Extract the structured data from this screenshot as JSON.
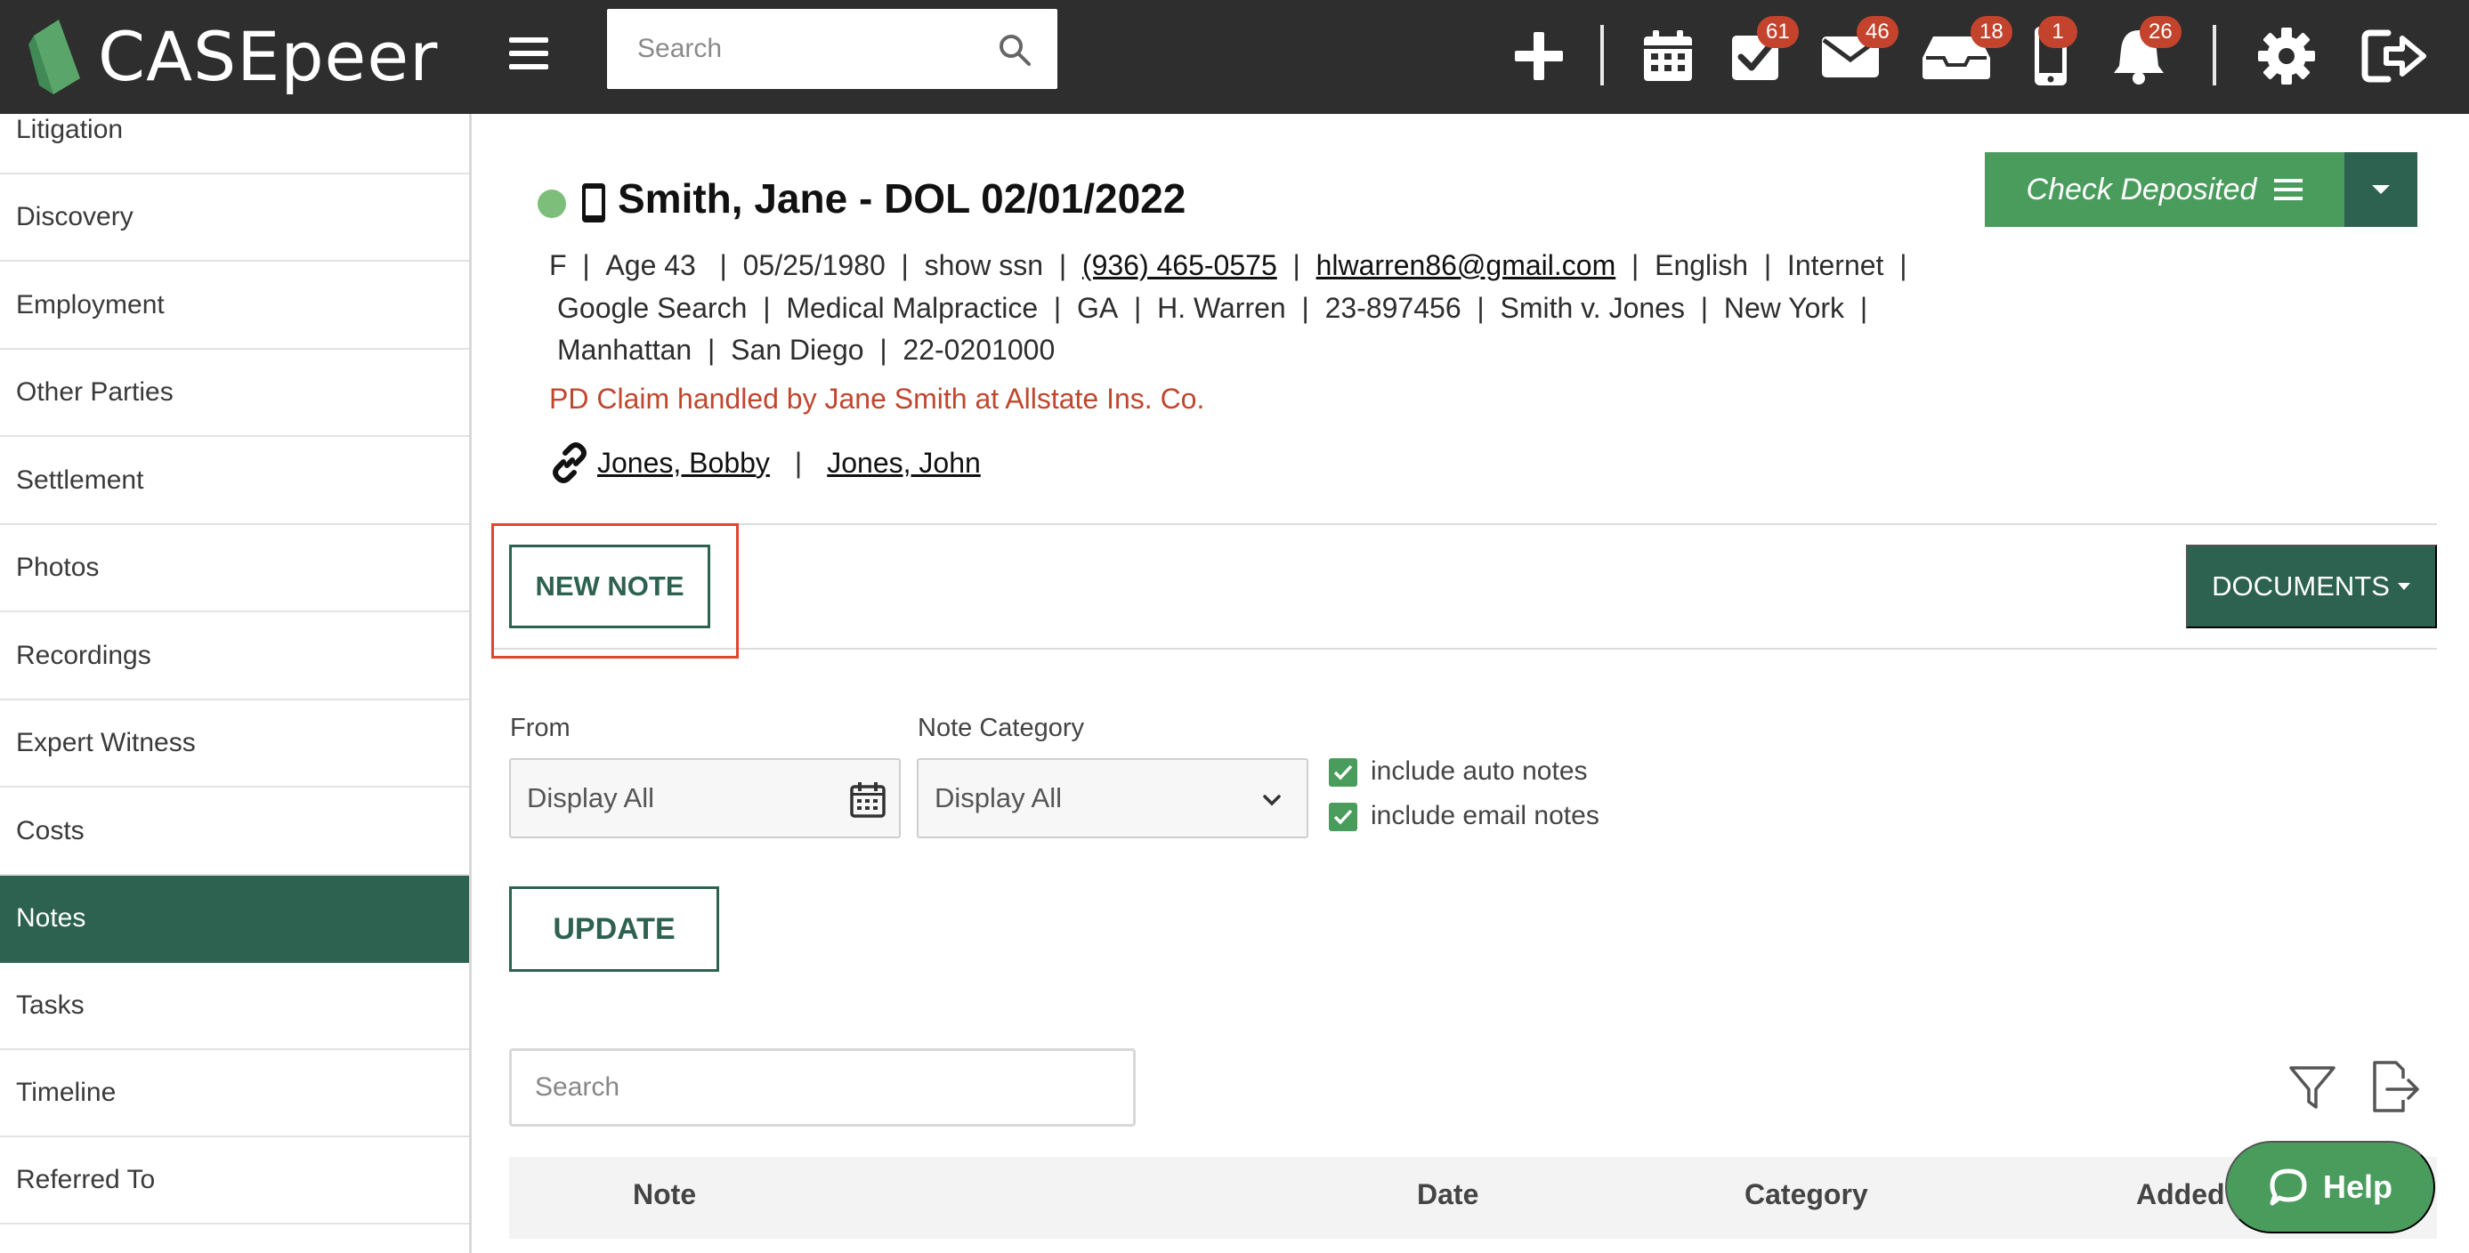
{
  "app": {
    "logo_text": "CASEpeer"
  },
  "topbar": {
    "search_placeholder": "Search",
    "badges": {
      "tasks": "61",
      "mail": "46",
      "inbox": "18",
      "phone": "1",
      "notifications": "26"
    }
  },
  "sidebar": {
    "items": [
      {
        "label": "Litigation"
      },
      {
        "label": "Discovery"
      },
      {
        "label": "Employment"
      },
      {
        "label": "Other Parties"
      },
      {
        "label": "Settlement"
      },
      {
        "label": "Photos"
      },
      {
        "label": "Recordings"
      },
      {
        "label": "Expert Witness"
      },
      {
        "label": "Costs"
      },
      {
        "label": "Notes"
      },
      {
        "label": "Tasks"
      },
      {
        "label": "Timeline"
      },
      {
        "label": "Referred To"
      }
    ],
    "active": "Notes"
  },
  "case": {
    "title": "Smith, Jane - DOL 02/01/2022",
    "line1": {
      "gender": "F",
      "age": "Age 43",
      "dob": "05/25/1980",
      "ssn": "show ssn",
      "phone": "(936) 465-0575",
      "email": "hlwarren86@gmail.com",
      "language": "English",
      "source": "Internet"
    },
    "line2": {
      "referral": "Google Search",
      "case_type": "Medical Malpractice",
      "state": "GA",
      "attorney": "H. Warren",
      "case_number": "23-897456",
      "caption": "Smith v. Jones",
      "county": "New York"
    },
    "line3": {
      "city": "Manhattan",
      "office": "San Diego",
      "file_number": "22-0201000"
    },
    "pd_claim": "PD Claim handled by Jane Smith at Allstate Ins. Co.",
    "linked_contacts": [
      "Jones, Bobby",
      "Jones, John"
    ]
  },
  "actions": {
    "check_deposited": "Check Deposited",
    "new_note": "NEW NOTE",
    "documents": "DOCUMENTS"
  },
  "filters": {
    "from_label": "From",
    "from_value": "Display All",
    "category_label": "Note Category",
    "category_value": "Display All",
    "include_auto_notes": "include auto notes",
    "include_email_notes": "include email notes",
    "update": "UPDATE"
  },
  "notes_table": {
    "search_placeholder": "Search",
    "columns": [
      "Note",
      "Date",
      "Category",
      "Added"
    ]
  },
  "help": {
    "label": "Help"
  },
  "colors": {
    "topbar": "#2e2e2e",
    "brand_green": "#2d6150",
    "accent_green": "#4a9c5d",
    "badge_red": "#c4432c",
    "highlight_red": "#e0452f"
  }
}
